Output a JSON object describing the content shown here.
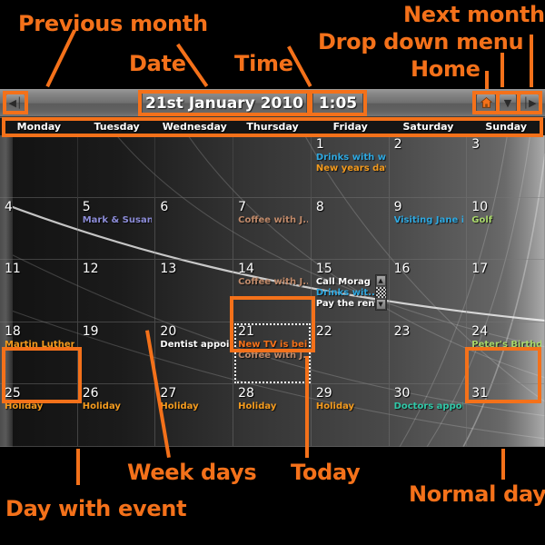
{
  "annotations": [
    {
      "id": "previous-month",
      "label": "Previous month"
    },
    {
      "id": "date",
      "label": "Date"
    },
    {
      "id": "time",
      "label": "Time"
    },
    {
      "id": "next-month",
      "label": "Next month"
    },
    {
      "id": "drop-down-menu",
      "label": "Drop down menu"
    },
    {
      "id": "home",
      "label": "Home"
    },
    {
      "id": "week-days",
      "label": "Week days"
    },
    {
      "id": "today",
      "label": "Today"
    },
    {
      "id": "day-with-event",
      "label": "Day with event"
    },
    {
      "id": "normal-day",
      "label": "Normal day"
    }
  ],
  "toolbar": {
    "prev_icon": "◀│",
    "next_icon": "│▶",
    "home_icon": "⌂",
    "dropdown_icon": "▼",
    "date": "21st January 2010",
    "time": "1:05"
  },
  "weekdays": [
    "Monday",
    "Tuesday",
    "Wednesday",
    "Thursday",
    "Friday",
    "Saturday",
    "Sunday"
  ],
  "colors": {
    "accent": "#F4711A",
    "event_orange": "#F49B1E",
    "event_cyan": "#2FA8E0",
    "event_white": "#FFFFFF",
    "event_tan": "#C08A6A",
    "event_green": "#A8D66A",
    "event_teal": "#30C8A8",
    "event_periwinkle": "#8C8CD8",
    "event_today": "#F4711A",
    "daynum": "#FFFFFF"
  },
  "calendar": {
    "weeks": [
      [
        {
          "day": "",
          "blank": true
        },
        {
          "day": "",
          "blank": true
        },
        {
          "day": "",
          "blank": true
        },
        {
          "day": "",
          "blank": true
        },
        {
          "day": "1",
          "events": [
            {
              "text": "Drinks with w...",
              "color": "event_cyan"
            },
            {
              "text": "New years day",
              "color": "event_orange"
            }
          ]
        },
        {
          "day": "2",
          "events": []
        },
        {
          "day": "3",
          "events": []
        }
      ],
      [
        {
          "day": "4",
          "events": []
        },
        {
          "day": "5",
          "events": [
            {
              "text": "Mark & Susan...",
              "color": "event_periwinkle"
            }
          ]
        },
        {
          "day": "6",
          "events": []
        },
        {
          "day": "7",
          "events": [
            {
              "text": "Coffee with J...",
              "color": "event_tan"
            }
          ]
        },
        {
          "day": "8",
          "events": []
        },
        {
          "day": "9",
          "events": [
            {
              "text": "Visiting Jane i...",
              "color": "event_cyan"
            }
          ]
        },
        {
          "day": "10",
          "events": [
            {
              "text": "Golf",
              "color": "event_green"
            }
          ]
        }
      ],
      [
        {
          "day": "11",
          "events": []
        },
        {
          "day": "12",
          "events": []
        },
        {
          "day": "13",
          "events": []
        },
        {
          "day": "14",
          "events": [
            {
              "text": "Coffee with J...",
              "color": "event_tan"
            }
          ]
        },
        {
          "day": "15",
          "scroll": true,
          "events": [
            {
              "text": "Call Morag",
              "color": "event_white"
            },
            {
              "text": "Drinks wit...",
              "color": "event_cyan"
            },
            {
              "text": "Pay the rent",
              "color": "event_white"
            }
          ]
        },
        {
          "day": "16",
          "events": []
        },
        {
          "day": "17",
          "events": []
        }
      ],
      [
        {
          "day": "18",
          "events": [
            {
              "text": "Martin Luther ...",
              "color": "event_orange"
            }
          ]
        },
        {
          "day": "19",
          "events": []
        },
        {
          "day": "20",
          "events": [
            {
              "text": "Dentist appoi...",
              "color": "event_white"
            }
          ]
        },
        {
          "day": "21",
          "today": true,
          "events": [
            {
              "text": "New TV is bei...",
              "color": "event_today"
            },
            {
              "text": "Coffee with J...",
              "color": "event_tan"
            }
          ]
        },
        {
          "day": "22",
          "events": []
        },
        {
          "day": "23",
          "events": []
        },
        {
          "day": "24",
          "events": [
            {
              "text": "Peter's Birthd...",
              "color": "event_green"
            }
          ]
        }
      ],
      [
        {
          "day": "25",
          "events": [
            {
              "text": "Holiday",
              "color": "event_orange"
            }
          ]
        },
        {
          "day": "26",
          "events": [
            {
              "text": "Holiday",
              "color": "event_orange"
            }
          ]
        },
        {
          "day": "27",
          "events": [
            {
              "text": "Holiday",
              "color": "event_orange"
            }
          ]
        },
        {
          "day": "28",
          "events": [
            {
              "text": "Holiday",
              "color": "event_orange"
            }
          ]
        },
        {
          "day": "29",
          "events": [
            {
              "text": "Holiday",
              "color": "event_orange"
            }
          ]
        },
        {
          "day": "30",
          "events": [
            {
              "text": "Doctors appoi...",
              "color": "event_teal"
            }
          ]
        },
        {
          "day": "31",
          "events": []
        }
      ]
    ]
  }
}
